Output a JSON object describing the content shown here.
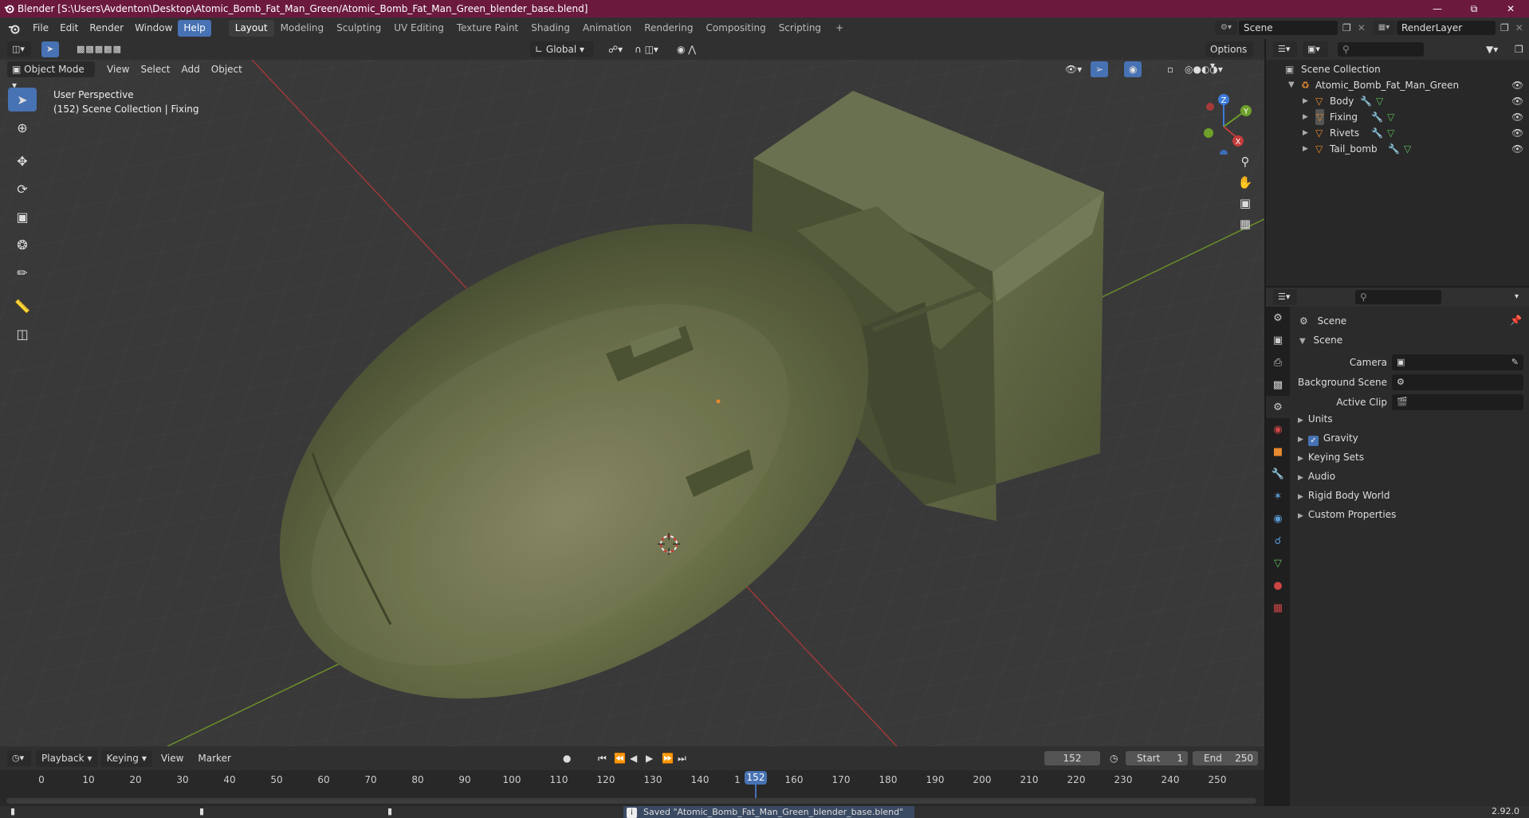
{
  "window": {
    "title": "Blender [S:\\Users\\Avdenton\\Desktop\\Atomic_Bomb_Fat_Man_Green/Atomic_Bomb_Fat_Man_Green_blender_base.blend]"
  },
  "menubar": {
    "menus": [
      "File",
      "Edit",
      "Render",
      "Window",
      "Help"
    ],
    "active_menu": "Help",
    "workspaces": [
      "Layout",
      "Modeling",
      "Sculpting",
      "UV Editing",
      "Texture Paint",
      "Shading",
      "Animation",
      "Rendering",
      "Compositing",
      "Scripting"
    ],
    "active_workspace": "Layout",
    "add_workspace": "+",
    "scene_field": "Scene",
    "renderlayer_field": "RenderLayer"
  },
  "viewport_header": {
    "mode": "Object Mode",
    "menus": [
      "View",
      "Select",
      "Add",
      "Object"
    ],
    "transform_orientation": "Global",
    "options_label": "Options"
  },
  "viewport": {
    "perspective_label": "User Perspective",
    "context_label": "(152) Scene Collection | Fixing",
    "gizmo_axes": {
      "z": "Z",
      "y": "Y",
      "x": "X"
    }
  },
  "toolbar_tools": [
    "select-box",
    "cursor",
    "move",
    "rotate",
    "scale",
    "transform",
    "annotate",
    "measure",
    "add-cube"
  ],
  "outliner": {
    "root": "Scene Collection",
    "collection": "Atomic_Bomb_Fat_Man_Green",
    "objects": [
      "Body",
      "Fixing",
      "Rivets",
      "Tail_bomb"
    ]
  },
  "properties": {
    "context_title": "Scene",
    "panel_title": "Scene",
    "fields": [
      {
        "label": "Camera",
        "value": ""
      },
      {
        "label": "Background Scene",
        "value": ""
      },
      {
        "label": "Active Clip",
        "value": ""
      }
    ],
    "subpanels": [
      {
        "label": "Units",
        "checkbox": false
      },
      {
        "label": "Gravity",
        "checkbox": true,
        "checked": true
      },
      {
        "label": "Keying Sets",
        "checkbox": false
      },
      {
        "label": "Audio",
        "checkbox": false
      },
      {
        "label": "Rigid Body World",
        "checkbox": false
      },
      {
        "label": "Custom Properties",
        "checkbox": false
      }
    ]
  },
  "timeline": {
    "menus": [
      "Playback",
      "Keying",
      "View",
      "Marker"
    ],
    "current_frame": "152",
    "start_label": "Start",
    "start_value": "1",
    "end_label": "End",
    "end_value": "250",
    "ticks": [
      "0",
      "10",
      "20",
      "30",
      "40",
      "50",
      "60",
      "70",
      "80",
      "90",
      "100",
      "110",
      "120",
      "130",
      "140",
      "160",
      "170",
      "180",
      "190",
      "200",
      "210",
      "220",
      "230",
      "240",
      "250"
    ],
    "tick_partial": "1",
    "playhead_label": "152"
  },
  "statusbar": {
    "message": "Saved \"Atomic_Bomb_Fat_Man_Green_blender_base.blend\"",
    "version": "2.92.0"
  },
  "colors": {
    "titlebar": "#6b1a3e",
    "accent": "#4772b3",
    "x_axis": "#c23b3b",
    "y_axis": "#6fa02a",
    "z_axis": "#3d7bd9",
    "object_orange": "#e88a2f",
    "mesh_green": "#5fbf5f",
    "bomb": "#5d6640"
  }
}
